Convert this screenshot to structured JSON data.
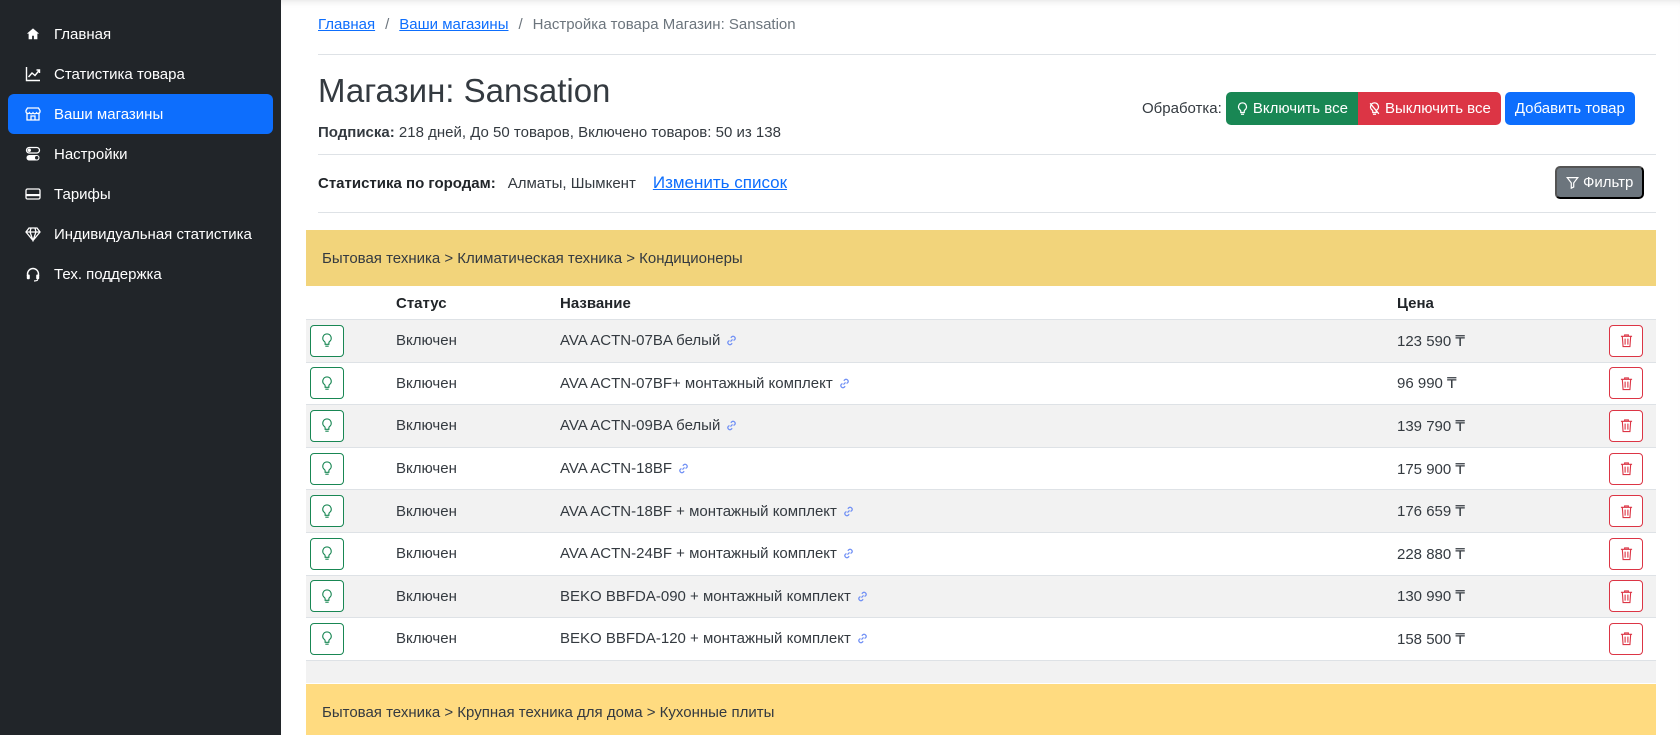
{
  "sidebar": {
    "items": [
      {
        "label": "Главная",
        "icon": "home-icon",
        "active": false
      },
      {
        "label": "Статистика товара",
        "icon": "chart-line-icon",
        "active": false
      },
      {
        "label": "Ваши магазины",
        "icon": "shop-icon",
        "active": true
      },
      {
        "label": "Настройки",
        "icon": "toggles-icon",
        "active": false
      },
      {
        "label": "Тарифы",
        "icon": "credit-card-icon",
        "active": false
      },
      {
        "label": "Индивидуальная статистика",
        "icon": "gem-icon",
        "active": false
      },
      {
        "label": "Тех. поддержка",
        "icon": "headset-icon",
        "active": false
      }
    ]
  },
  "breadcrumb": {
    "home": "Главная",
    "shops": "Ваши магазины",
    "current": "Настройка товара Магазин: Sansation",
    "separator": "/"
  },
  "header": {
    "title": "Магазин: Sansation",
    "subscription_label": "Подписка:",
    "subscription_text": "218 дней, До 50 товаров, Включено товаров: 50 из 138"
  },
  "processing": {
    "label": "Обработка:",
    "enable_all": "Включить все",
    "disable_all": "Выключить все",
    "add_product": "Добавить товар"
  },
  "cities": {
    "label": "Статистика по городам:",
    "value": "Алматы, Шымкент",
    "change_link": "Изменить список"
  },
  "filter": {
    "label": "Фильтр"
  },
  "categories": [
    "Бытовая техника > Климатическая техника > Кондиционеры",
    "Бытовая техника > Крупная техника для дома > Кухонные плиты"
  ],
  "table": {
    "headers": {
      "status": "Статус",
      "name": "Название",
      "price": "Цена"
    },
    "rows": [
      {
        "status": "Включен",
        "name": "AVA ACTN-07BA белый",
        "price": "123 590 ₸"
      },
      {
        "status": "Включен",
        "name": "AVA ACTN-07BF+ монтажный комплект",
        "price": "96 990 ₸"
      },
      {
        "status": "Включен",
        "name": "AVA ACTN-09BA белый",
        "price": "139 790 ₸"
      },
      {
        "status": "Включен",
        "name": "AVA ACTN-18BF",
        "price": "175 900 ₸"
      },
      {
        "status": "Включен",
        "name": "AVA ACTN-18BF + монтажный комплект",
        "price": "176 659 ₸"
      },
      {
        "status": "Включен",
        "name": "AVA ACTN-24BF + монтажный комплект",
        "price": "228 880 ₸"
      },
      {
        "status": "Включен",
        "name": "BEKO BBFDA-090 + монтажный комплект",
        "price": "130 990 ₸"
      },
      {
        "status": "Включен",
        "name": "BEKO BBFDA-120 + монтажный комплект",
        "price": "158 500 ₸"
      }
    ]
  },
  "colors": {
    "sidebar_bg": "#212529",
    "active": "#0d6efd",
    "success": "#198754",
    "danger": "#dc3545",
    "secondary": "#6c757d",
    "category_band": "#f2d47b"
  }
}
